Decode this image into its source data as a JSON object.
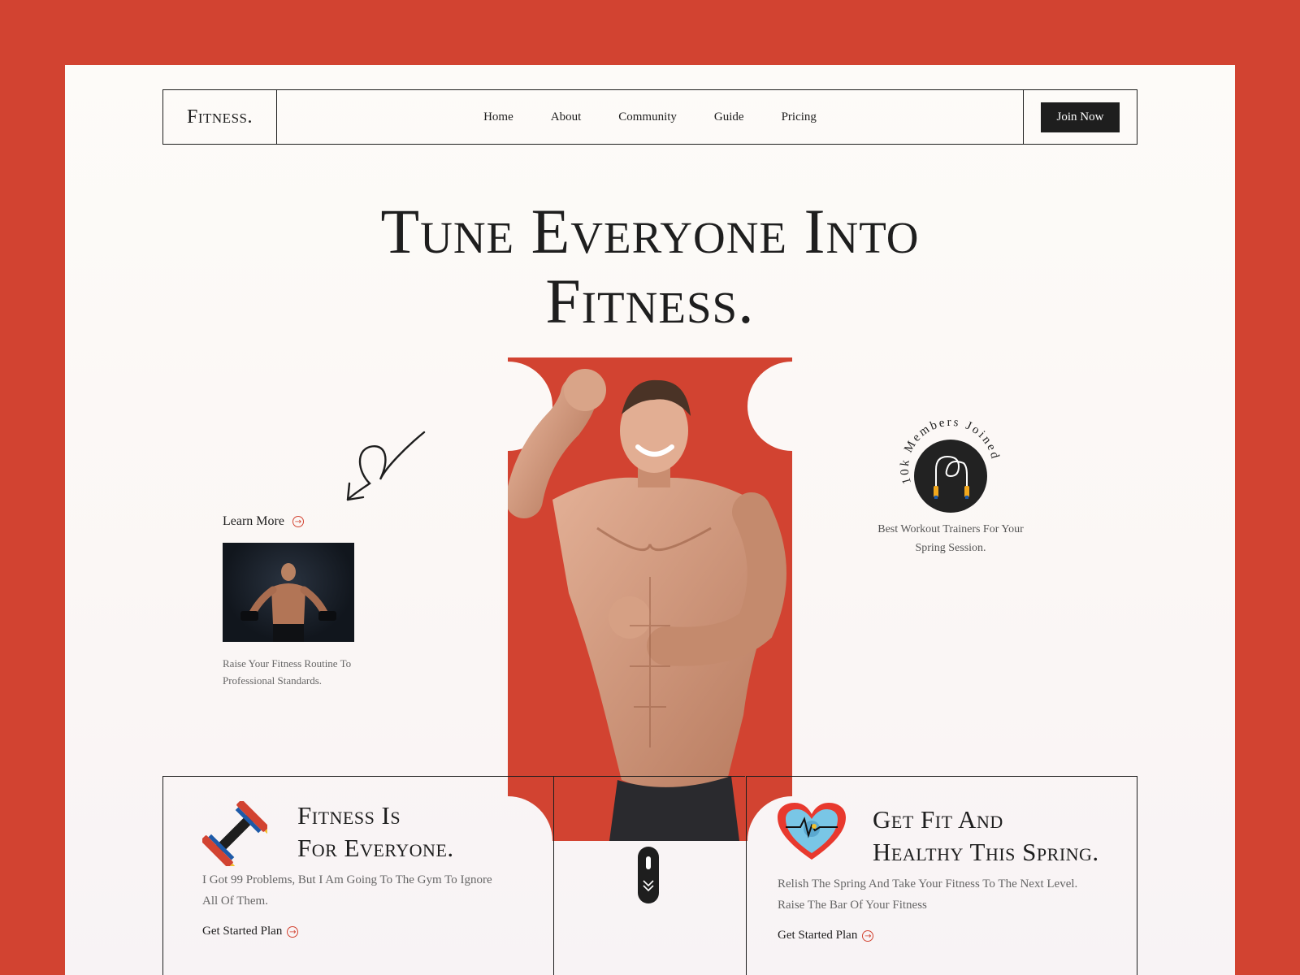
{
  "nav": {
    "logo": "Fitness.",
    "links": [
      "Home",
      "About",
      "Community",
      "Guide",
      "Pricing"
    ],
    "join_label": "Join Now"
  },
  "hero": {
    "title_line1": "Tune Everyone Into",
    "title_line2": "Fitness."
  },
  "left": {
    "learn_more": "Learn More",
    "description": "Raise Your Fitness Routine To Professional Standards."
  },
  "right": {
    "badge_text": "10k Members Joined",
    "description": "Best Workout Trainers For Your Spring Session."
  },
  "panels": {
    "left": {
      "title_line1": "Fitness Is",
      "title_line2": "For Everyone.",
      "text": "I Got 99 Problems, But I Am Going To The Gym To Ignore All Of Them.",
      "cta": "Get Started Plan"
    },
    "right": {
      "title_line1": "Get Fit And",
      "title_line2": "Healthy This Spring.",
      "text": "Relish The Spring And Take Your Fitness To The Next Level. Raise The Bar Of Your Fitness",
      "cta": "Get Started Plan"
    }
  },
  "colors": {
    "accent": "#D24331",
    "dark": "#1E1E1E",
    "page_bg": "#FCF9F7"
  },
  "icons": {
    "arrow": "curly-arrow-icon",
    "circle_arrow": "circle-arrow-icon",
    "jump_rope": "jump-rope-icon",
    "dumbbell": "dumbbell-icon",
    "heart": "heart-pulse-icon",
    "scroll": "scroll-down-icon"
  }
}
